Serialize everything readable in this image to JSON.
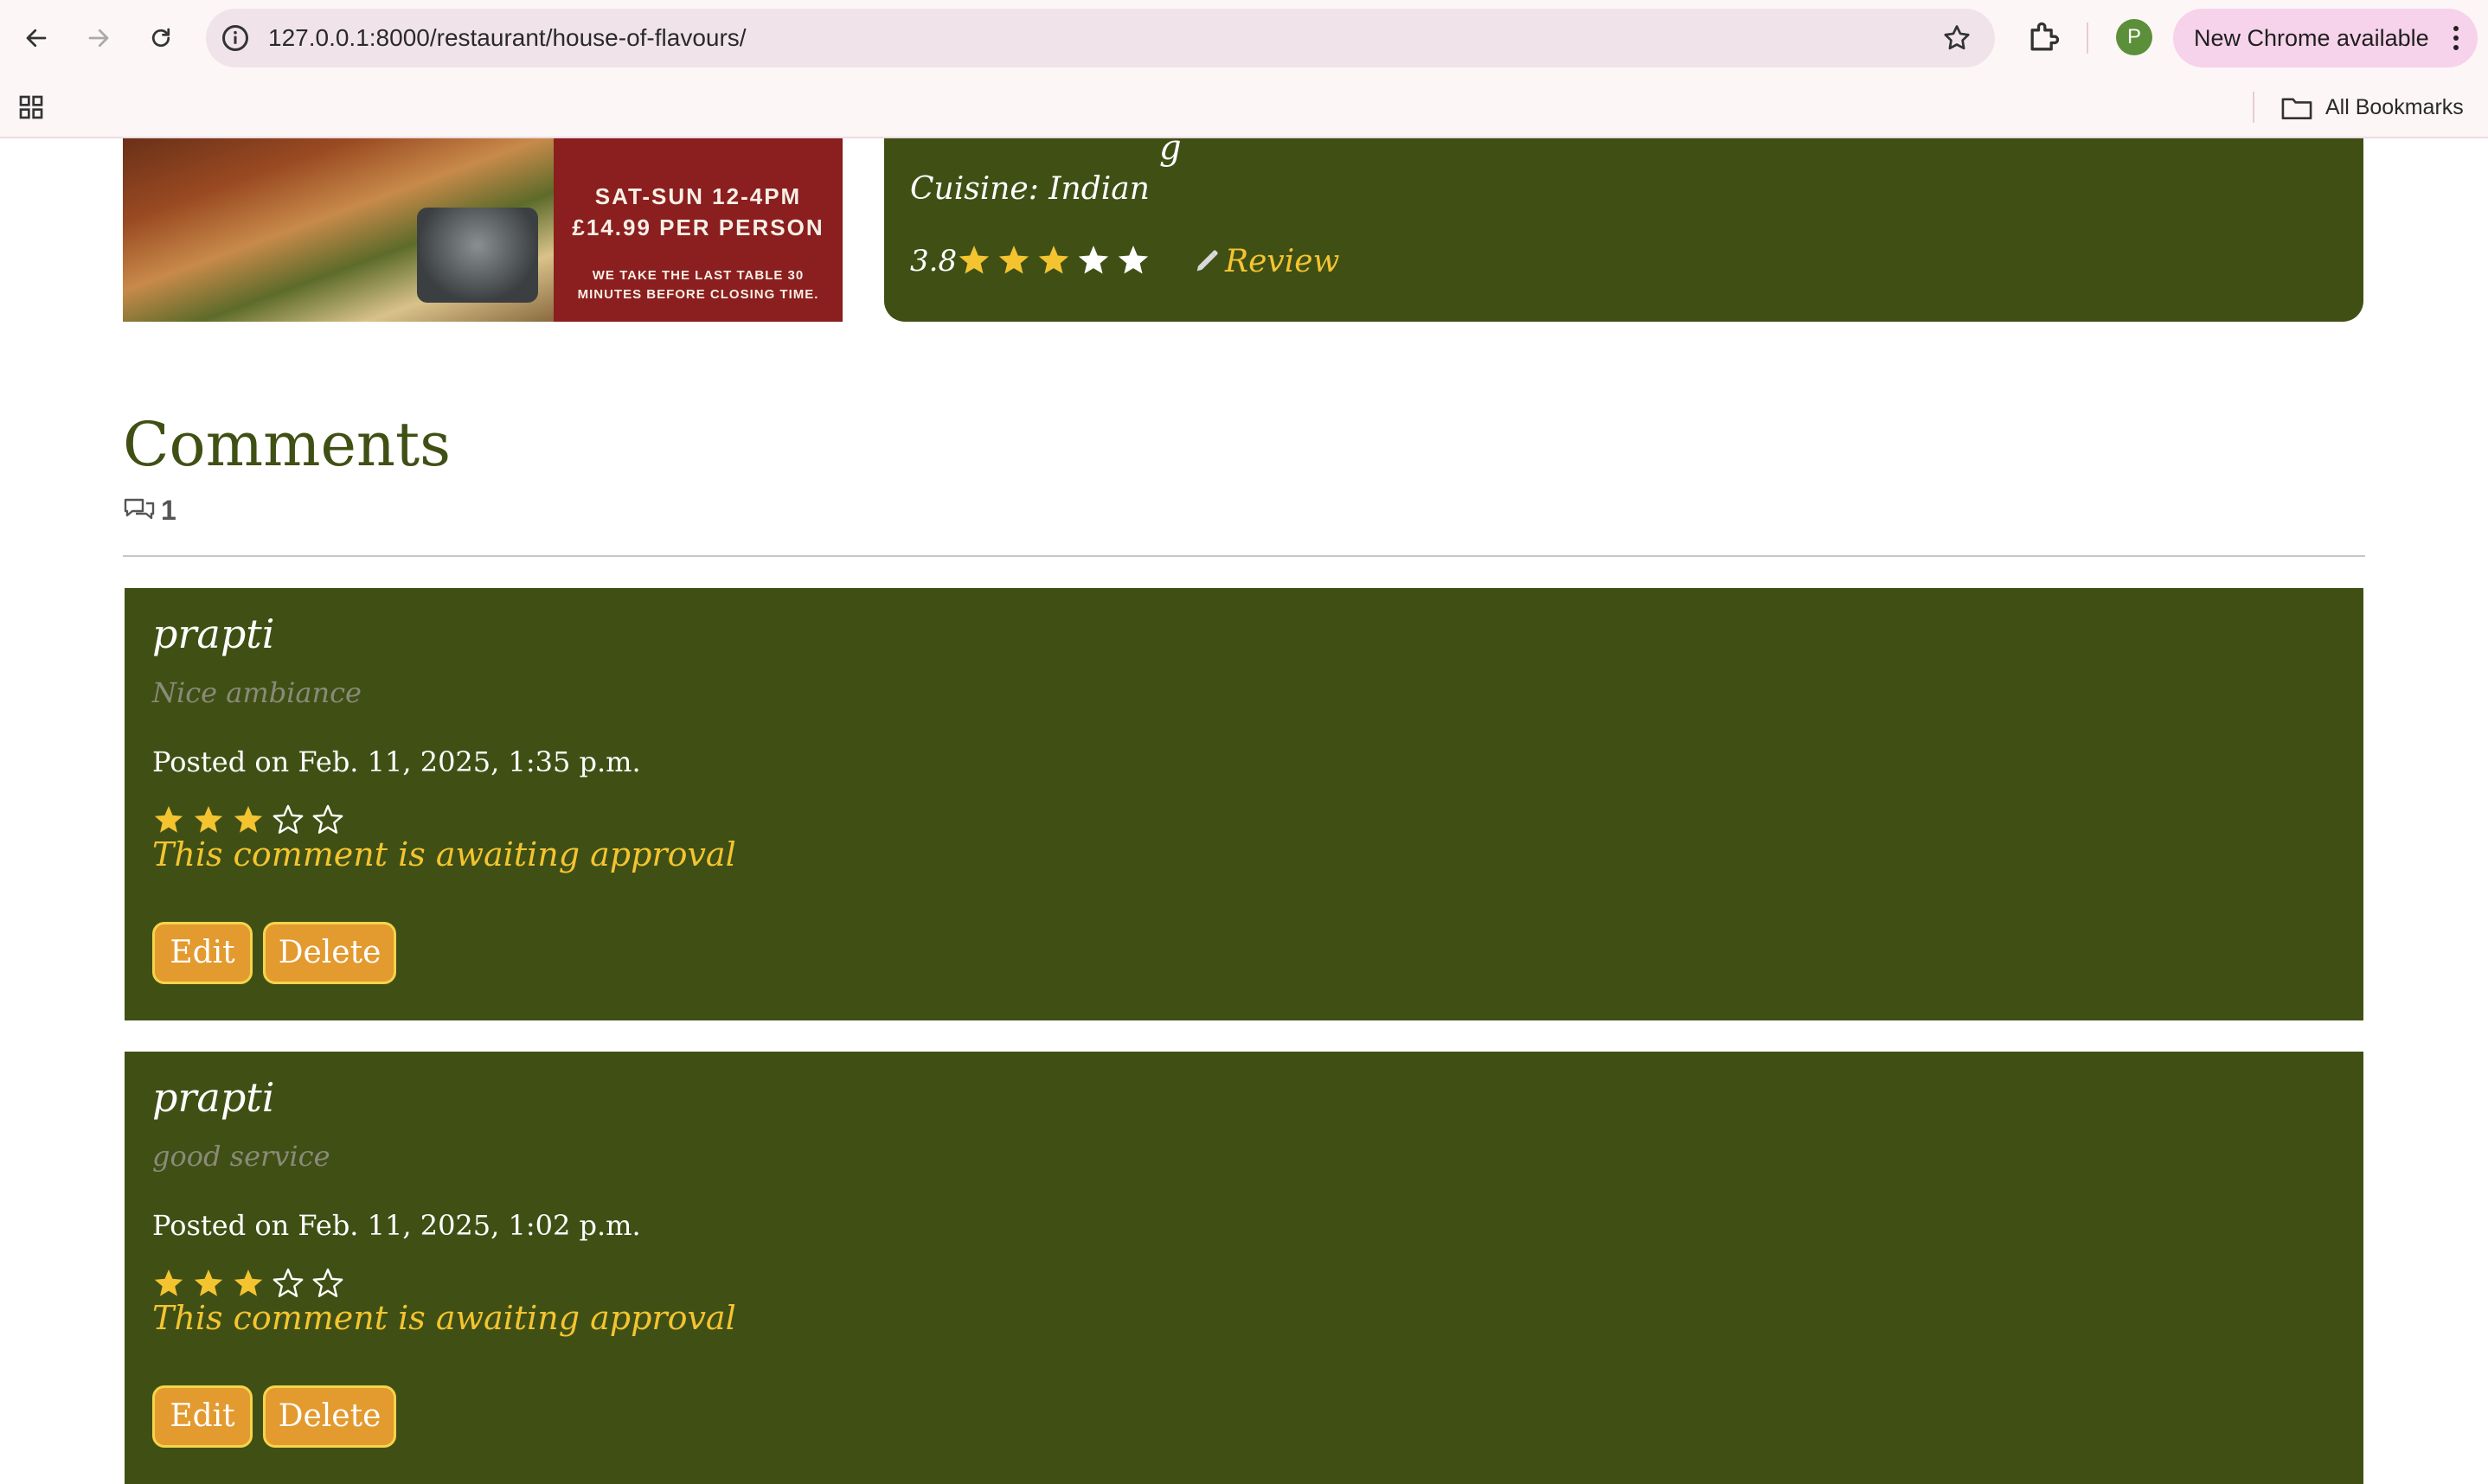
{
  "browser": {
    "url": "127.0.0.1:8000/restaurant/house-of-flavours/",
    "update_label": "New Chrome available",
    "profile_initial": "P",
    "bookmarks_label": "All Bookmarks"
  },
  "hero": {
    "promo_line1": "SAT-SUN 12-4PM",
    "promo_line2": "£14.99 PER PERSON",
    "promo_line3": "WE TAKE THE LAST TABLE 30 MINUTES BEFORE CLOSING TIME."
  },
  "restaurant": {
    "cuisine_label": "Cuisine: Indian",
    "rating": "3.8",
    "rating_stars_filled": 3,
    "rating_stars_total": 5,
    "review_label": "Review"
  },
  "comments_section": {
    "title": "Comments",
    "count": "1"
  },
  "comments": [
    {
      "author": "prapti",
      "body": "Nice ambiance",
      "posted": "Posted on Feb. 11, 2025, 1:35 p.m.",
      "stars_filled": 3,
      "stars_total": 5,
      "status": "This comment is awaiting approval",
      "edit_label": "Edit",
      "delete_label": "Delete"
    },
    {
      "author": "prapti",
      "body": "good service",
      "posted": "Posted on Feb. 11, 2025, 1:02 p.m.",
      "stars_filled": 3,
      "stars_total": 5,
      "status": "This comment is awaiting approval",
      "edit_label": "Edit",
      "delete_label": "Delete"
    }
  ],
  "colors": {
    "card_green": "#405015",
    "star_gold": "#f4c430",
    "button_orange": "#e39a2e"
  }
}
